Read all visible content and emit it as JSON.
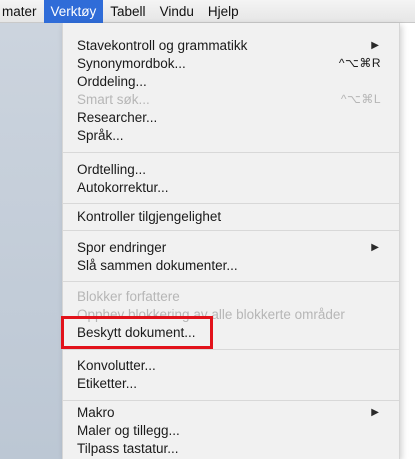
{
  "menubar": {
    "items": [
      {
        "label": "mater",
        "active": false
      },
      {
        "label": "Verktøy",
        "active": true
      },
      {
        "label": "Tabell",
        "active": false
      },
      {
        "label": "Vindu",
        "active": false
      },
      {
        "label": "Hjelp",
        "active": false
      }
    ]
  },
  "menu": {
    "group1": {
      "spelling": {
        "label": "Stavekontroll og grammatikk"
      },
      "thesaurus": {
        "label": "Synonymordbok...",
        "shortcut": "^⌥⌘R"
      },
      "hyphenation": {
        "label": "Orddeling..."
      },
      "smart_search": {
        "label": "Smart søk...",
        "shortcut": "^⌥⌘L"
      },
      "researcher": {
        "label": "Researcher..."
      },
      "language": {
        "label": "Språk..."
      }
    },
    "group2": {
      "word_count": {
        "label": "Ordtelling..."
      },
      "autocorrect": {
        "label": "Autokorrektur..."
      }
    },
    "group3": {
      "accessibility": {
        "label": "Kontroller tilgjengelighet"
      }
    },
    "group4": {
      "track_changes": {
        "label": "Spor endringer"
      },
      "merge_documents": {
        "label": "Slå sammen dokumenter..."
      }
    },
    "group5": {
      "block_authors": {
        "label": "Blokker forfattere"
      },
      "remove_blocking": {
        "label": "Opphev blokkering av alle blokkerte områder"
      },
      "protect_document": {
        "label": "Beskytt dokument..."
      }
    },
    "group6": {
      "envelopes": {
        "label": "Konvolutter..."
      },
      "labels": {
        "label": "Etiketter..."
      }
    },
    "group7": {
      "macro": {
        "label": "Makro"
      },
      "templates": {
        "label": "Maler og tillegg..."
      },
      "customize_keyboard": {
        "label": "Tilpass tastatur..."
      }
    }
  },
  "colors": {
    "menubar_active": "#2f6cd8",
    "highlight_box": "#e2121b",
    "disabled_text": "#b6b6b6"
  }
}
